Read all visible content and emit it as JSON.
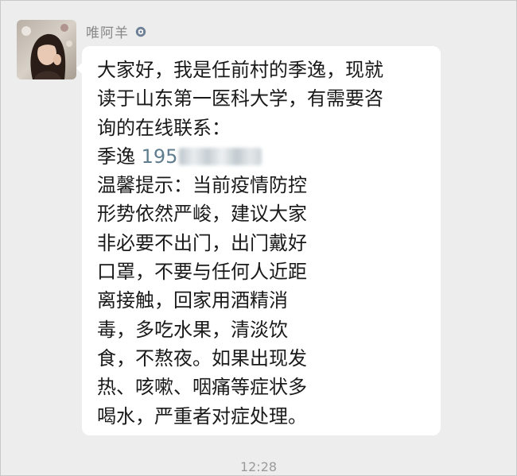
{
  "sender": {
    "name": "唯阿羊",
    "tag_icon": "tag-icon"
  },
  "message": {
    "lines": [
      "大家好，我是任前村的季逸，现就",
      "读于山东第一医科大学，有需要咨",
      "询的在线联系：",
      "季逸 195",
      "温馨提示：当前疫情防控",
      "形势依然严峻，建议大家",
      "非必要不出门，出门戴好",
      "口罩，不要与任何人近距",
      "离接触，回家用酒精消",
      "毒，多吃水果，清淡饮",
      "食，不熬夜。如果出现发",
      "热、咳嗽、咽痛等症状多",
      "喝水，严重者对症处理。"
    ],
    "contact_name": "季逸",
    "phone_prefix": "195",
    "phone_color": "#5f7d8f"
  },
  "timestamp": "12:28",
  "colors": {
    "background": "#ededed",
    "bubble": "#ffffff",
    "sender_name": "#888888",
    "timestamp": "#9a9a9a"
  }
}
